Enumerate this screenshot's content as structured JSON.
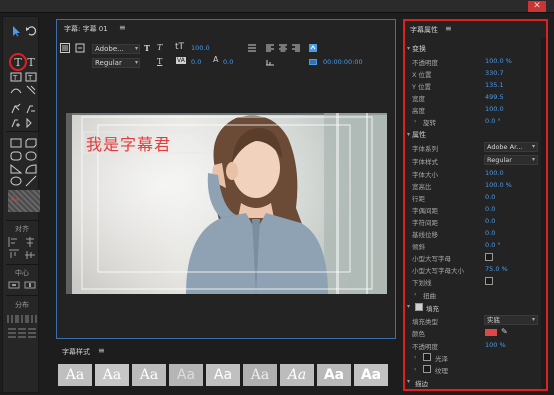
{
  "window": {
    "close": "✕"
  },
  "tools": {
    "align_label": "对齐",
    "center_label": "中心",
    "distribute_label": "分布",
    "swatch_text": "Aa"
  },
  "center_panel": {
    "title": "字幕: 字幕 01",
    "menu": "≡",
    "font_family": "Adobe...",
    "font_style": "Regular",
    "size_value": "100.0",
    "kern_value": "0.0",
    "lead_value": "0.0",
    "timecode": "00:00:00:00",
    "subtitle_text": "我是字幕君",
    "styles_title": "字幕样式",
    "styles": [
      "Aa",
      "Aa",
      "Aa",
      "Aa",
      "Aa",
      "Aa",
      "Aa",
      "Aa",
      "Aa"
    ]
  },
  "right_panel": {
    "title": "字幕属性",
    "menu": "≡",
    "transform": "变换",
    "opacity_label": "不透明度",
    "opacity_value": "100.0 %",
    "x_label": "X 位置",
    "x_value": "330.7",
    "y_label": "Y 位置",
    "y_value": "135.1",
    "width_label": "宽度",
    "width_value": "499.5",
    "height_label": "高度",
    "height_value": "100.0",
    "rotate_label": "旋转",
    "rotate_value": "0.0 °",
    "properties": "属性",
    "family_label": "字体系列",
    "family_value": "Adobe Ar...",
    "style_label": "字体样式",
    "style_value": "Regular",
    "size_label": "字体大小",
    "size_value": "100.0",
    "aspect_label": "宽高比",
    "aspect_value": "100.0 %",
    "leading_label": "行距",
    "leading_value": "0.0",
    "kerning_label": "字偶间距",
    "kerning_value": "0.0",
    "tracking_label": "字符间距",
    "tracking_value": "0.0",
    "baseline_label": "基线位移",
    "baseline_value": "0.0",
    "slant_label": "倾斜",
    "slant_value": "0.0 °",
    "smallcaps_label": "小型大写字母",
    "smallcaps_size_label": "小型大写字母大小",
    "smallcaps_size_value": "75.0 %",
    "underline_label": "下划线",
    "distort_label": "扭曲",
    "fill_label": "填充",
    "fill_type_label": "填充类型",
    "fill_type_value": "实底",
    "color_label": "颜色",
    "fill_opacity_label": "不透明度",
    "fill_opacity_value": "100 %",
    "sheen_label": "光泽",
    "texture_label": "纹理",
    "stroke_label": "描边"
  },
  "colors": {
    "accent": "#4a9bea",
    "highlight": "#e02020",
    "subtitle": "#e53b3b"
  }
}
